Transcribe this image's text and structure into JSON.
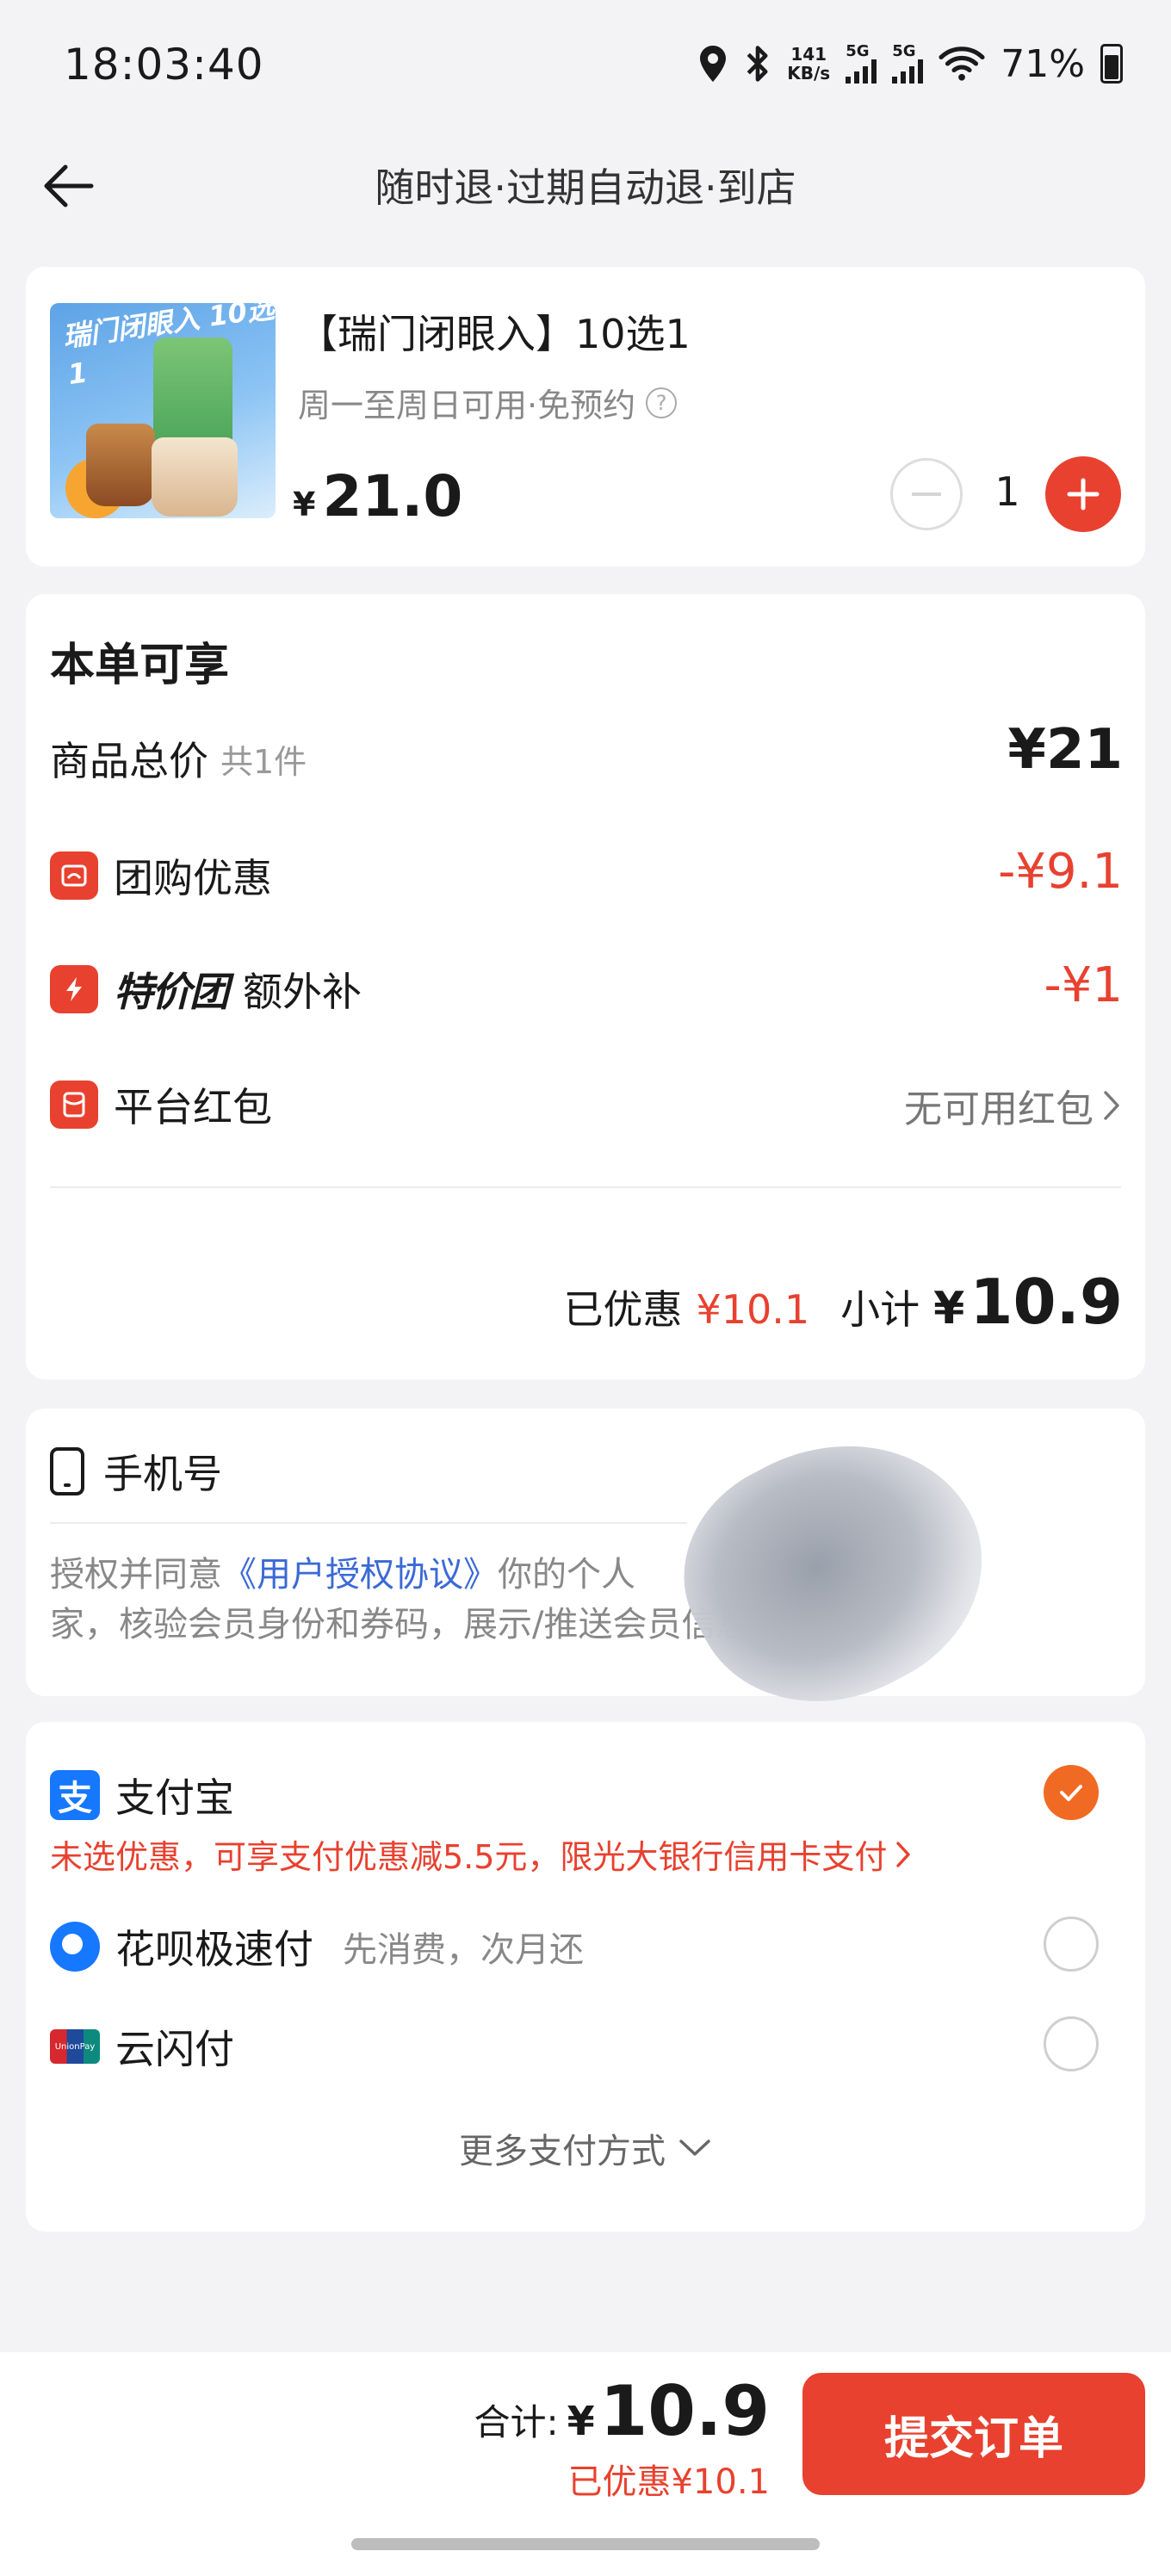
{
  "status_bar": {
    "time": "18:03:40",
    "net_speed_value": "141",
    "net_speed_unit": "KB/s",
    "sim1_label": "5G",
    "sim2_label": "5G",
    "battery": "71%",
    "icons": [
      "location-icon",
      "bluetooth-icon",
      "signal-icon",
      "wifi-icon",
      "battery-icon"
    ]
  },
  "nav": {
    "title": "随时退·过期自动退·到店",
    "back_icon": "back-arrow-icon"
  },
  "product": {
    "title": "【瑞门闭眼入】10选1",
    "subtitle": "周一至周日可用·免预约",
    "image_text": "瑞门闭眼入 10选1",
    "price_currency": "¥",
    "price": "21.0",
    "quantity": "1"
  },
  "summary": {
    "title": "本单可享",
    "total_label": "商品总价",
    "total_count": "共1件",
    "total_value": "¥21",
    "group_label": "团购优惠",
    "group_value": "-¥9.1",
    "special_logo": "特价团",
    "special_label": "额外补",
    "special_value": "-¥1",
    "redpack_label": "平台红包",
    "redpack_value": "无可用红包",
    "discounted_label": "已优惠",
    "discounted_value": "¥10.1",
    "subtotal_label": "小计",
    "subtotal_currency": "¥",
    "subtotal_value": "10.9"
  },
  "phone": {
    "title": "手机号",
    "auth_prefix": "授权并同意",
    "auth_link": "《用户授权协议》",
    "auth_line1_rest": "你的个人",
    "auth_line2": "家，核验会员身份和券码，展示/推送会员信息"
  },
  "payment": {
    "alipay_label": "支付宝",
    "alipay_icon_char": "支",
    "alipay_promo": "未选优惠，可享支付优惠减5.5元，限光大银行信用卡支付",
    "huabei_label": "花呗极速付",
    "huabei_sub": "先消费，次月还",
    "unionpay_label": "云闪付",
    "unionpay_icon_text": "UnionPay",
    "more_label": "更多支付方式",
    "selected": "alipay"
  },
  "bottom": {
    "total_label": "合计:",
    "total_currency": "¥",
    "total_value": "10.9",
    "discount_text": "已优惠¥10.1",
    "submit_label": "提交订单"
  },
  "colors": {
    "accent": "#e8412f",
    "radio_selected": "#f06a24",
    "link": "#3b6ad6",
    "alipay_blue": "#1677ff"
  }
}
